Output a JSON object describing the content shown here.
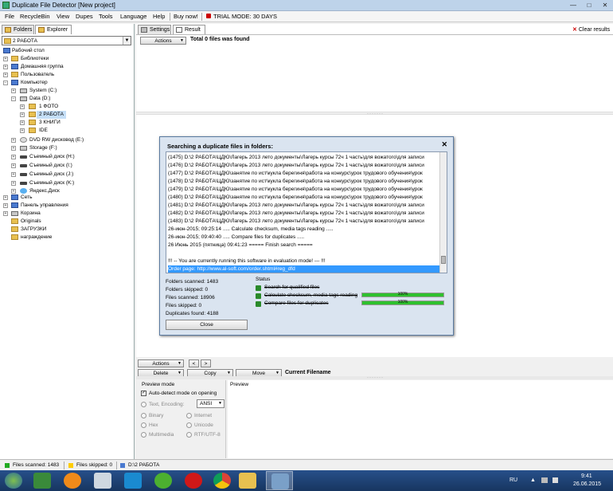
{
  "window": {
    "title": "Duplicate File Detector [New project]",
    "controls": [
      "—",
      "□",
      "✕"
    ]
  },
  "menu": {
    "items": [
      "File",
      "RecycleBin",
      "View",
      "Dupes",
      "Tools",
      "Language",
      "Help",
      "Buy now!"
    ],
    "trial": "TRIAL MODE: 30 DAYS"
  },
  "left_tabs": [
    "Folders",
    "Explorer"
  ],
  "path_combo": "2 РАБОТА",
  "tree": [
    {
      "label": "Рабочий стол",
      "icon": "desktop-icon"
    },
    {
      "label": "Библиотеки",
      "icon": "folder-icon"
    },
    {
      "label": "Домашняя группа",
      "icon": "homegroup-icon"
    },
    {
      "label": "Пользователь",
      "icon": "folder-icon"
    },
    {
      "label": "Компьютер",
      "icon": "computer-icon"
    },
    {
      "label": "System (C:)",
      "icon": "drive-icon"
    },
    {
      "label": "Data (D:)",
      "icon": "drive-icon"
    },
    {
      "label": "1 ФОТО",
      "icon": "folder-icon"
    },
    {
      "label": "2 РАБОТА",
      "icon": "folder-icon"
    },
    {
      "label": "3 КНИГИ",
      "icon": "folder-icon"
    },
    {
      "label": "IDE",
      "icon": "folder-icon"
    },
    {
      "label": "DVD RW дисковод (E:)",
      "icon": "dvd-icon"
    },
    {
      "label": "Storage (F:)",
      "icon": "drive-icon"
    },
    {
      "label": "Съемный диск (H:)",
      "icon": "removable-drive-icon"
    },
    {
      "label": "Съемный диск (I:)",
      "icon": "removable-drive-icon"
    },
    {
      "label": "Съемный диск (J:)",
      "icon": "removable-drive-icon"
    },
    {
      "label": "Съемный диск (K:)",
      "icon": "removable-drive-icon"
    },
    {
      "label": "Яндекс.Диск",
      "icon": "yandex-disk-icon"
    },
    {
      "label": "Сеть",
      "icon": "network-icon"
    },
    {
      "label": "Панель управления",
      "icon": "control-panel-icon"
    },
    {
      "label": "Корзина",
      "icon": "recycle-bin-icon"
    },
    {
      "label": "Originals",
      "icon": "folder-icon"
    },
    {
      "label": "ЗАГРУЗКИ",
      "icon": "folder-icon"
    },
    {
      "label": "награждение",
      "icon": "folder-icon"
    }
  ],
  "right_tabs": [
    "Settings",
    "Result"
  ],
  "clear_results": "Clear results",
  "results": {
    "actions": "Actions",
    "summary": "Total 0 files was found"
  },
  "bottom_toolbar": {
    "actions": "Actions",
    "prev": "<",
    "next": ">",
    "delete": "Delete",
    "copy": "Copy",
    "move": "Move",
    "current_filename": "Current Filename"
  },
  "preview_mode": {
    "title": "Preview mode",
    "auto_detect": "Auto-detect mode on opening",
    "text_encoding": "Text, Encoding:",
    "encoding_value": "ANSI",
    "options": [
      "Binary",
      "Internet",
      "Hex",
      "Unicode",
      "Multimedia",
      "RTF/UTF-8"
    ]
  },
  "preview_label": "Preview",
  "dialog": {
    "title": "Searching a duplicate files in folders:",
    "log": [
      "(1475)  D:\\2 РАБОТА\\ЦДЮ\\Лагерь 2013 лето документы\\Лагерь курсы 72ч 1 часть\\для вожатого\\для записи",
      "(1476)  D:\\2 РАБОТА\\ЦДЮ\\Лагерь 2013 лето документы\\Лагерь курсы 72ч 1 часть\\для вожатого\\для записи",
      "(1477)  D:\\2 РАБОТА\\ЦДЮ\\занятие по ист\\кукла берегиня\\работа на конкурс\\урок трудового обучения\\урок",
      "(1478)  D:\\2 РАБОТА\\ЦДЮ\\занятие по ист\\кукла берегиня\\работа на конкурс\\урок трудового обучения\\урок",
      "(1479)  D:\\2 РАБОТА\\ЦДЮ\\занятие по ист\\кукла берегиня\\работа на конкурс\\урок трудового обучения\\урок",
      "(1480)  D:\\2 РАБОТА\\ЦДЮ\\занятие по ист\\кукла берегиня\\работа на конкурс\\урок трудового обучения\\урок",
      "(1481)  D:\\2 РАБОТА\\ЦДЮ\\Лагерь 2013 лето документы\\Лагерь курсы 72ч 1 часть\\для вожатого\\для записи",
      "(1482)  D:\\2 РАБОТА\\ЦДЮ\\Лагерь 2013 лето документы\\Лагерь курсы 72ч 1 часть\\для вожатого\\для записи",
      "(1483)  D:\\2 РАБОТА\\ЦДЮ\\Лагерь 2013 лето документы\\Лагерь курсы 72ч 1 часть\\для вожатого\\для записи",
      "26-июн-2015; 09:25:14   ..... Calculate checksum, media tags reading .....",
      "26-июн-2015; 09:40:40   ..... Compare files for duplicates .....",
      "26 Июнь 2015 (пятница) 09:41:23 ===== Finish search =====",
      "",
      "!!! -- You are currently running this software in evaluation mode! --- !!!",
      "Order page:  http://www.al-soft.com/order.shtml#reg_dfd"
    ],
    "stats": [
      "Folders scanned: 1483",
      "Folders skipped: 0",
      "Files scanned: 18906",
      "Files skipped: 0",
      "Duplicates found: 4188"
    ],
    "status_title": "Status",
    "status_items": [
      {
        "label": "Search for qualified files",
        "progress": null
      },
      {
        "label": "Calculate checksum, media tags reading",
        "progress": 1.0,
        "text": "100%"
      },
      {
        "label": "Compare files for duplicates",
        "progress": 1.0,
        "text": "100%"
      }
    ],
    "close": "Close"
  },
  "statusbar": {
    "scanned": "Files scanned: 1483",
    "skipped": "Files skipped: 0",
    "path": "D:\\2 РАБОТА"
  },
  "taskbar": {
    "lang": "RU",
    "time": "9:41",
    "date": "26.06.2015",
    "apps": [
      "start-icon",
      "app-x-icon",
      "avast-icon",
      "calculator-icon",
      "tv-icon",
      "utorrent-icon",
      "opera-icon",
      "chrome-icon",
      "folder-icon",
      "duplicate-detector-icon"
    ]
  },
  "colors": {
    "accent": "#3399ff",
    "progress": "#2ec02e",
    "taskbar": "#1f4575",
    "selection": "#c5dff7"
  }
}
